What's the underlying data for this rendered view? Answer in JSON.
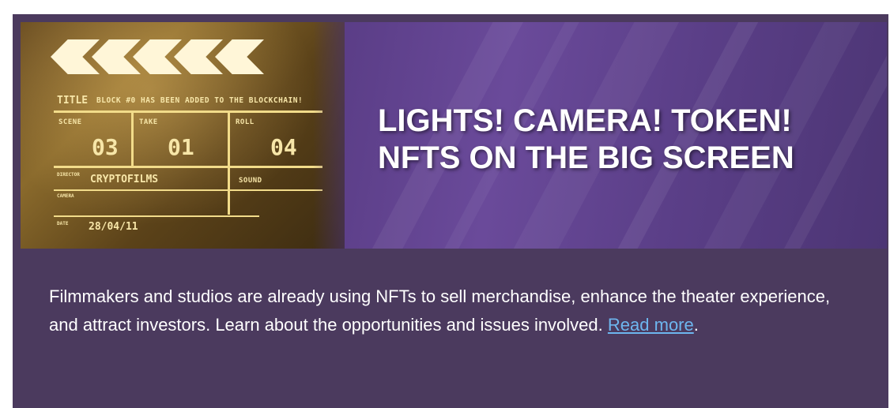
{
  "banner": {
    "headline_line1": "LIGHTS! CAMERA! TOKEN!",
    "headline_line2": "NFTS ON THE BIG SCREEN",
    "clapperboard": {
      "title_label": "TITLE",
      "title_value": "BLOCK #0 HAS BEEN ADDED TO THE BLOCKCHAIN!",
      "scene_label": "SCENE",
      "scene_value": "03",
      "take_label": "TAKE",
      "take_value": "01",
      "roll_label": "ROLL",
      "roll_value": "04",
      "director_label": "DIRECTOR",
      "director_value": "CRYPTOFILMS",
      "camera_label": "CAMERA",
      "sound_label": "SOUND",
      "date_label": "DATE",
      "date_value": "28/04/11"
    }
  },
  "article": {
    "description": "Filmmakers and studios are already using NFTs to sell merchandise, enhance the theater experience, and attract investors. Learn about the opportunities and issues involved.",
    "link_text": "Read more",
    "trailing": "."
  },
  "colors": {
    "card_background": "#4b3a5e",
    "link": "#6db6ef",
    "headline": "#ffffff"
  }
}
